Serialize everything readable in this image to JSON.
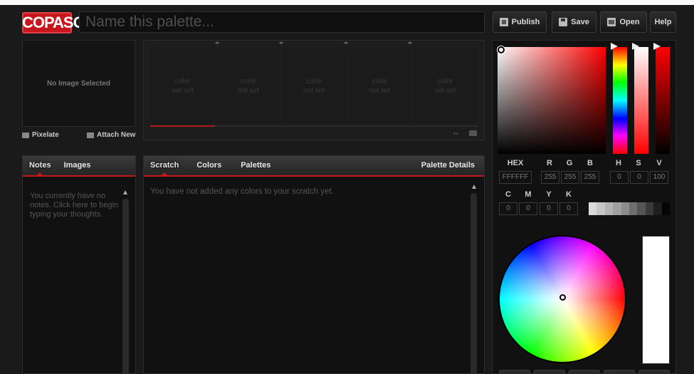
{
  "header": {
    "logo": "COPASO",
    "name_placeholder": "Name this palette...",
    "publish": "Publish",
    "save": "Save",
    "open": "Open",
    "help": "Help"
  },
  "image_panel": {
    "empty_text": "No Image Selected",
    "pixelate": "Pixelate",
    "attach_new": "Attach New"
  },
  "swatches": [
    {
      "label": "color\nnot set"
    },
    {
      "label": "color\nnot set"
    },
    {
      "label": "color\nnot set"
    },
    {
      "label": "color\nnot set"
    },
    {
      "label": "color\nnot set"
    }
  ],
  "notes_panel": {
    "tabs": [
      "Notes",
      "Images"
    ],
    "active_tab": "Notes",
    "empty_text": "You currently have no notes. Click here to begin typing your thoughts."
  },
  "scratch_panel": {
    "tabs": [
      "Scratch",
      "Colors",
      "Palettes"
    ],
    "active_tab": "Scratch",
    "details": "Palette Details",
    "empty_text": "You have not added any colors to your scratch yet."
  },
  "picker": {
    "labels": {
      "hex": "HEX",
      "r": "R",
      "g": "G",
      "b": "B",
      "h": "H",
      "s": "S",
      "v": "V",
      "c": "C",
      "m": "M",
      "y": "Y",
      "k": "K"
    },
    "hex": "FFFFFF",
    "r": "255",
    "g": "255",
    "b": "255",
    "h": "0",
    "s": "0",
    "v": "100",
    "c": "0",
    "m": "0",
    "y": "0",
    "k": "0",
    "current_color": "#ffffff",
    "greyscale": [
      "#d9d9d9",
      "#c6c6c6",
      "#b3b3b3",
      "#a0a0a0",
      "#8c8c8c",
      "#6f6f6f",
      "#555555",
      "#3a3a3a",
      "#1f1f1f",
      "#050505"
    ]
  },
  "colors": {
    "accent": "#c8161d",
    "background": "#1a1a1a"
  }
}
